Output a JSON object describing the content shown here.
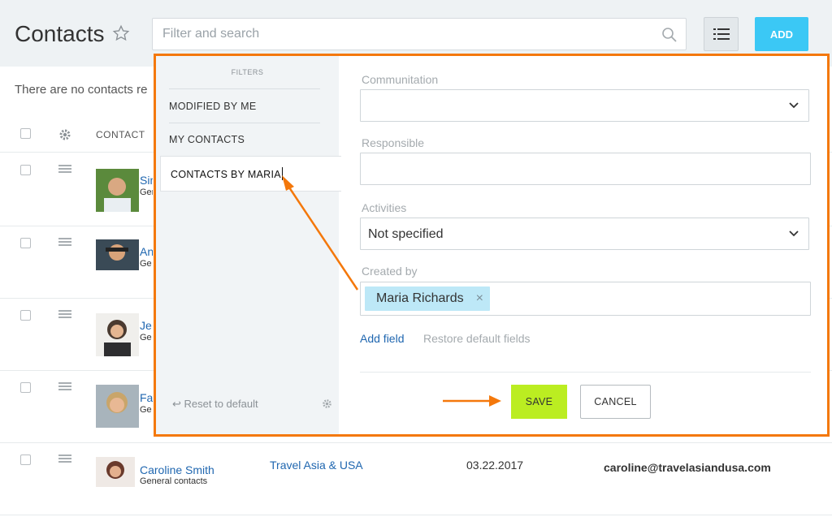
{
  "header": {
    "title": "Contacts",
    "search_placeholder": "Filter and search",
    "add_label": "ADD"
  },
  "list": {
    "empty_message": "There are no contacts re",
    "column_contact": "CONTACT",
    "rows": [
      {
        "name": "Sim",
        "sub": "Gene",
        "avatar_color": "#5b8a3c"
      },
      {
        "name": "An",
        "sub": "Ge",
        "avatar_color": "#3a4a56"
      },
      {
        "name": "Je",
        "sub": "Ge",
        "avatar_color": "#4a3a30"
      },
      {
        "name": "Fa",
        "sub": "Ge",
        "avatar_color": "#c9a56a"
      },
      {
        "name": "Caroline Smith",
        "sub": "General contacts",
        "company": "Travel Asia & USA",
        "date": "03.22.2017",
        "email": "caroline@travelasiandusa.com",
        "avatar_color": "#6a3a2c"
      }
    ]
  },
  "filters": {
    "title": "FILTERS",
    "items": [
      "MODIFIED BY ME",
      "MY CONTACTS"
    ],
    "active_item": "CONTACTS BY MARIA",
    "reset_label": "Reset to default"
  },
  "fields": {
    "communication_label": "Communitation",
    "communication_value": "",
    "responsible_label": "Responsible",
    "activities_label": "Activities",
    "activities_value": "Not specified",
    "created_by_label": "Created by",
    "created_by_tag": "Maria Richards",
    "add_field": "Add field",
    "restore_fields": "Restore default fields"
  },
  "actions": {
    "save": "SAVE",
    "cancel": "CANCEL"
  },
  "colors": {
    "accent_orange": "#f4780b",
    "add_blue": "#3bc8f5",
    "save_green": "#bbed21",
    "link_blue": "#2067b0"
  }
}
